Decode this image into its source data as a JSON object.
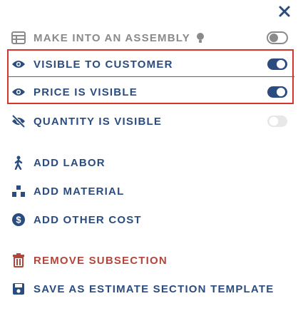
{
  "panel": {
    "close_label": "×",
    "items": [
      {
        "id": "assembly",
        "label": "MAKE INTO AN ASSEMBLY",
        "icon": "table-icon",
        "toggle": "off"
      },
      {
        "id": "visible-customer",
        "label": "VISIBLE TO CUSTOMER",
        "icon": "eye-icon",
        "toggle": "on"
      },
      {
        "id": "price-visible",
        "label": "PRICE IS VISIBLE",
        "icon": "eye-icon",
        "toggle": "on"
      },
      {
        "id": "quantity-visible",
        "label": "QUANTITY IS VISIBLE",
        "icon": "eye-slash-icon",
        "toggle": "off"
      }
    ],
    "actions": [
      {
        "id": "add-labor",
        "label": "ADD LABOR",
        "icon": "person-walking-icon"
      },
      {
        "id": "add-material",
        "label": "ADD MATERIAL",
        "icon": "boxes-icon"
      },
      {
        "id": "add-other-cost",
        "label": "ADD OTHER COST",
        "icon": "dollar-circle-icon"
      },
      {
        "id": "remove-subsection",
        "label": "REMOVE SUBSECTION",
        "icon": "trash-icon"
      },
      {
        "id": "save-template",
        "label": "SAVE AS ESTIMATE SECTION TEMPLATE",
        "icon": "save-icon"
      }
    ]
  },
  "colors": {
    "primary": "#2b4c7e",
    "danger": "#b5443b",
    "muted": "#8a8a8a",
    "highlight": "#d9342b"
  }
}
